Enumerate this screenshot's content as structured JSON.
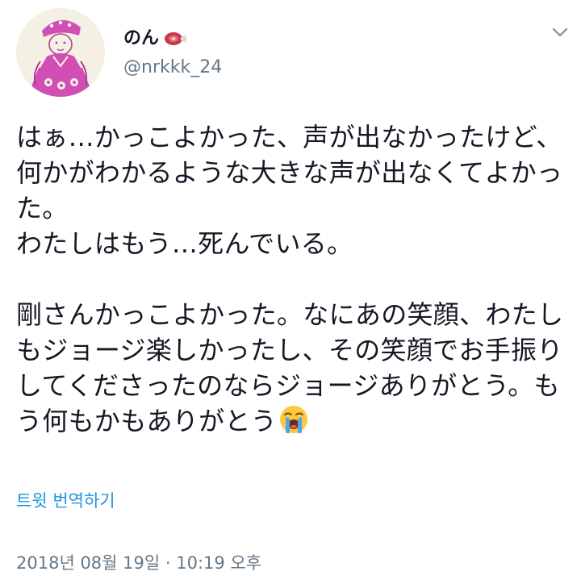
{
  "user": {
    "display_name": "のん",
    "display_name_emoji": "meat-on-bone-icon",
    "handle": "@nrkkk_24"
  },
  "tweet": {
    "paragraphs": [
      "はぁ…かっこよかった、声が出なかったけど、何かがわかるような大きな声が出なくてよかった。\nわたしはもう…死んでいる。",
      "剛さんかっこよかった。なにあの笑顔、わたしもジョージ楽しかったし、その笑顔でお手振りしてくださったのならジョージありがとう。もう何もかもありがとう"
    ],
    "trailing_emoji": "loudly-crying-face-icon"
  },
  "translate_label": "트윗 번역하기",
  "timestamp": "2018년 08월 19일 · 10:19 오후",
  "colors": {
    "text": "#141823",
    "secondary": "#657786",
    "link": "#1b95e0",
    "avatar_pink": "#d14fb5"
  }
}
